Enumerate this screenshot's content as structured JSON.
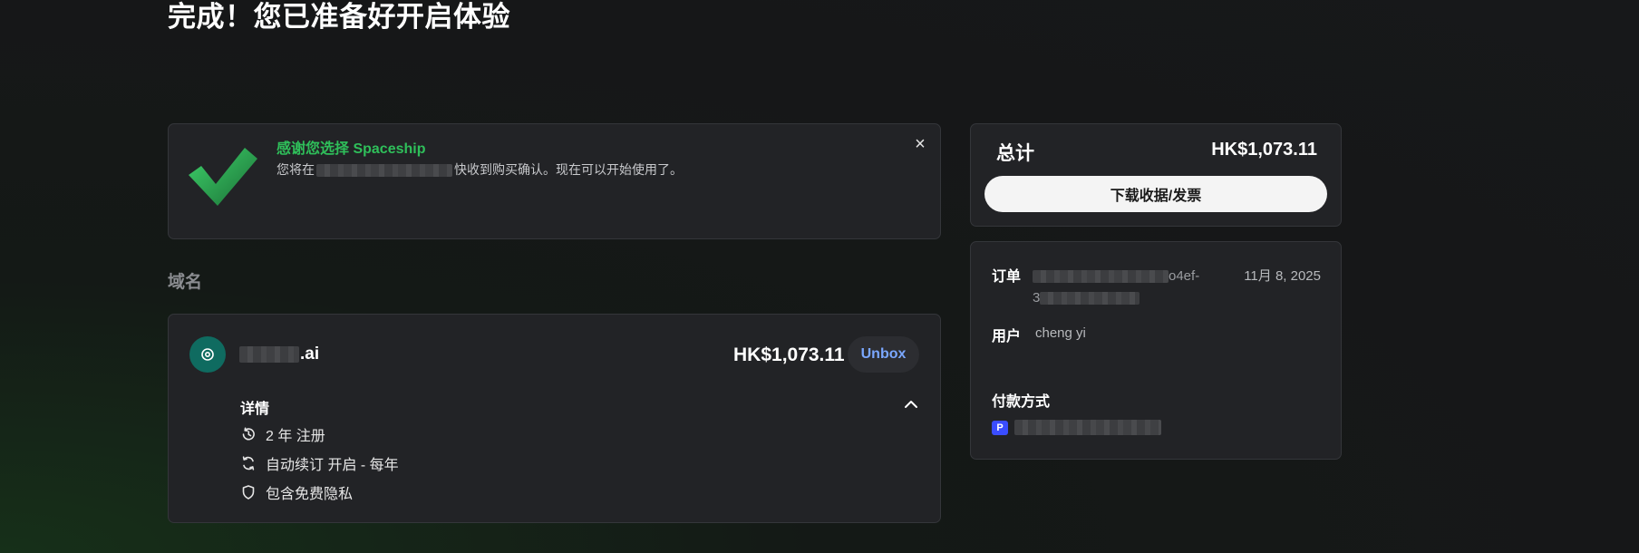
{
  "page": {
    "title": "完成！您已准备好开启体验"
  },
  "thanks_card": {
    "title": "感谢您选择 Spaceship",
    "text_before": "您将在",
    "text_after": "快收到购买确认。现在可以开始使用了。",
    "close_label": "×"
  },
  "section": {
    "domains_label": "域名"
  },
  "domain_item": {
    "suffix": ".ai",
    "price": "HK$1,073.11",
    "unbox_label": "Unbox",
    "details_label": "详情",
    "details": [
      {
        "icon": "history-icon",
        "text": "2 年 注册"
      },
      {
        "icon": "renew-icon",
        "text": "自动续订 开启 - 每年"
      },
      {
        "icon": "shield-icon",
        "text": "包含免费隐私"
      }
    ]
  },
  "summary": {
    "total_label": "总计",
    "total_value": "HK$1,073.11",
    "download_label": "下载收据/发票"
  },
  "order": {
    "order_label": "订单",
    "order_id_visible_1": "o4ef-",
    "order_id_visible_2": "3",
    "order_date": "11月 8, 2025",
    "user_label": "用户",
    "user_name": "cheng yi",
    "payment_label": "付款方式",
    "payment_icon": "P"
  },
  "colors": {
    "accent_green": "#2fbf5a",
    "link_blue": "#7aa7ff",
    "card_bg": "#222326",
    "teal": "#0f6b60"
  }
}
